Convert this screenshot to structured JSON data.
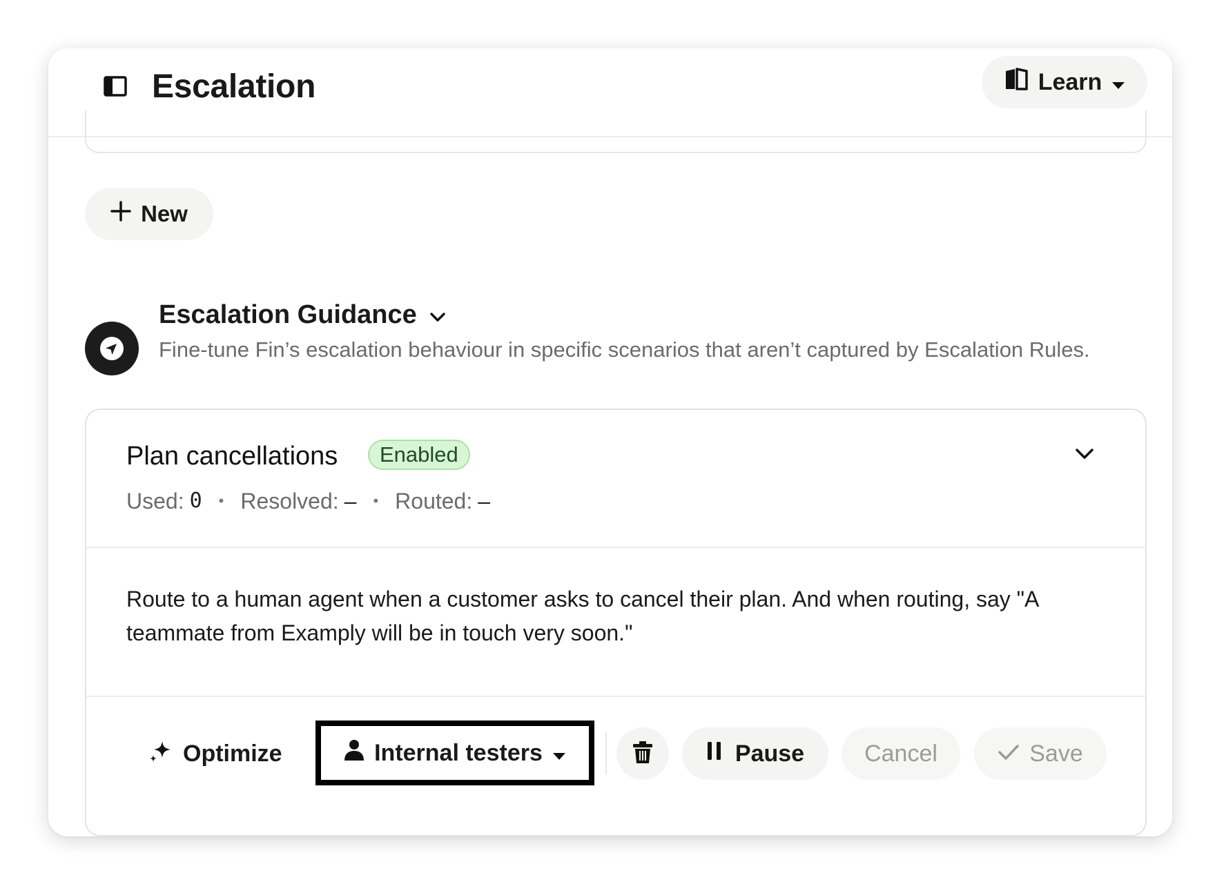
{
  "header": {
    "title": "Escalation",
    "learn_label": "Learn"
  },
  "actions": {
    "new_label": "New"
  },
  "section": {
    "title": "Escalation Guidance",
    "description": "Fine-tune Fin’s escalation behaviour in specific scenarios that aren’t captured by Escalation Rules."
  },
  "rule": {
    "title": "Plan cancellations",
    "status": "Enabled",
    "stats": {
      "used_label": "Used:",
      "used_value": "0",
      "resolved_label": "Resolved:",
      "resolved_value": "–",
      "routed_label": "Routed:",
      "routed_value": "–",
      "separator": "•"
    },
    "instruction": "Route to a human agent when a customer asks to cancel their plan. And when routing, say \"A teammate from Examply will be in touch very soon.\""
  },
  "footer": {
    "optimize_label": "Optimize",
    "audience_label": "Internal testers",
    "pause_label": "Pause",
    "cancel_label": "Cancel",
    "save_label": "Save"
  },
  "icons": {
    "sidebar": "sidebar-toggle-icon",
    "learn": "book-open-icon",
    "new": "plus-icon",
    "guidance": "compass-icon",
    "title_chevron": "chevron-down-icon",
    "card_chevron": "chevron-down-icon",
    "optimize": "sparkles-icon",
    "audience": "person-icon",
    "delete": "trash-icon",
    "pause": "pause-icon",
    "save": "check-icon"
  },
  "colors": {
    "badge_bg": "#d9f5d7",
    "badge_border": "#a8e2a4",
    "badge_text": "#1f4d22",
    "pill_bg": "#f4f4f3",
    "muted_text": "#6b6b6b",
    "disabled_text": "#9b9b9b"
  }
}
